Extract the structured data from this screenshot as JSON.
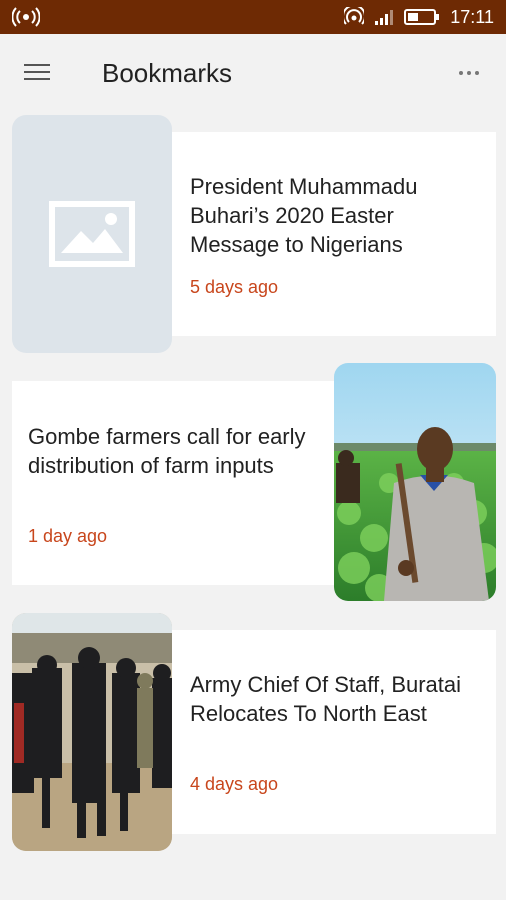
{
  "status_bar": {
    "time": "17:11",
    "background": "#6e2a04"
  },
  "app_bar": {
    "title": "Bookmarks"
  },
  "bookmarks": [
    {
      "title": "President Muhammadu Buhari’s 2020 Easter Message to Nigerians",
      "time": "5 days ago",
      "image": "placeholder-image-icon"
    },
    {
      "title": "Gombe farmers call for early distribution of farm inputs",
      "time": "1 day ago",
      "image": "farmer-photo"
    },
    {
      "title": "Army Chief Of Staff, Buratai Relocates To North East",
      "time": "4 days ago",
      "image": "soldiers-photo"
    }
  ],
  "colors": {
    "accent": "#c8461c",
    "background": "#f2f2f2"
  }
}
